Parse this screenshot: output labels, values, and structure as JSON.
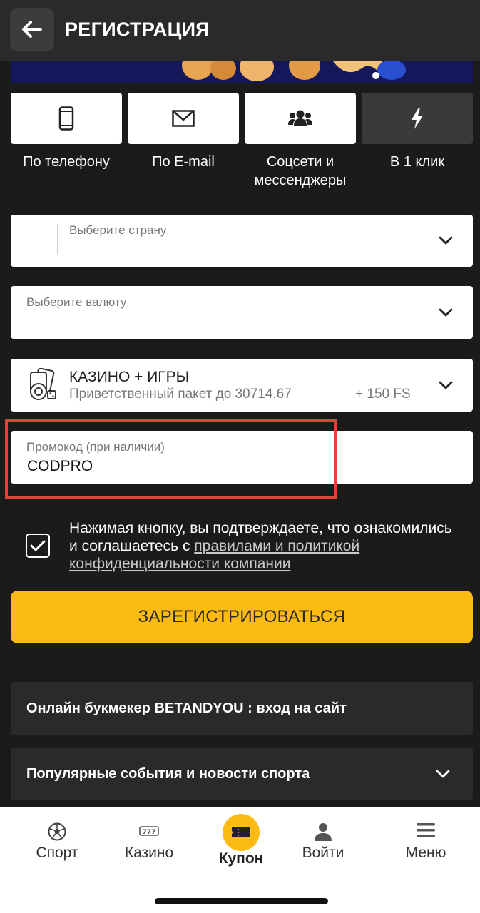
{
  "header": {
    "title": "РЕГИСТРАЦИЯ"
  },
  "tabs": [
    {
      "label": "По телефону",
      "icon": "phone-icon"
    },
    {
      "label": "По E-mail",
      "icon": "envelope-icon"
    },
    {
      "label_line1": "Соцсети и",
      "label_line2": "мессенджеры",
      "icon": "users-icon"
    },
    {
      "label": "В 1 клик",
      "icon": "lightning-icon",
      "active": true
    }
  ],
  "form": {
    "country_label": "Выберите страну",
    "currency_label": "Выберите валюту",
    "bonus": {
      "title": "КАЗИНО + ИГРЫ",
      "subtitle": "Приветственный пакет до 30714.67",
      "fs": "+ 150 FS"
    },
    "promo": {
      "label": "Промокод (при наличии)",
      "value": "CODPRO"
    },
    "terms": {
      "text": "Нажимая кнопку, вы подтверждаете, что ознакомились и соглашаетесь с ",
      "link": "правилами и политикой конфиденциальности компании",
      "checked": true
    },
    "submit_label": "ЗАРЕГИСТРИРОВАТЬСЯ"
  },
  "info": [
    {
      "title": "Онлайн букмекер BETANDYOU : вход на сайт"
    },
    {
      "title": "Популярные события и новости спорта"
    }
  ],
  "bottom_nav": [
    {
      "label": "Спорт",
      "icon": "soccer-ball-icon"
    },
    {
      "label": "Казино",
      "icon": "slot-777-icon"
    },
    {
      "label": "Купон",
      "icon": "ticket-icon",
      "active": true
    },
    {
      "label": "Войти",
      "icon": "user-icon"
    },
    {
      "label": "Меню",
      "icon": "hamburger-icon"
    }
  ],
  "colors": {
    "accent": "#fbbb12",
    "background": "#1b1b1b",
    "highlight": "#e0423c"
  }
}
